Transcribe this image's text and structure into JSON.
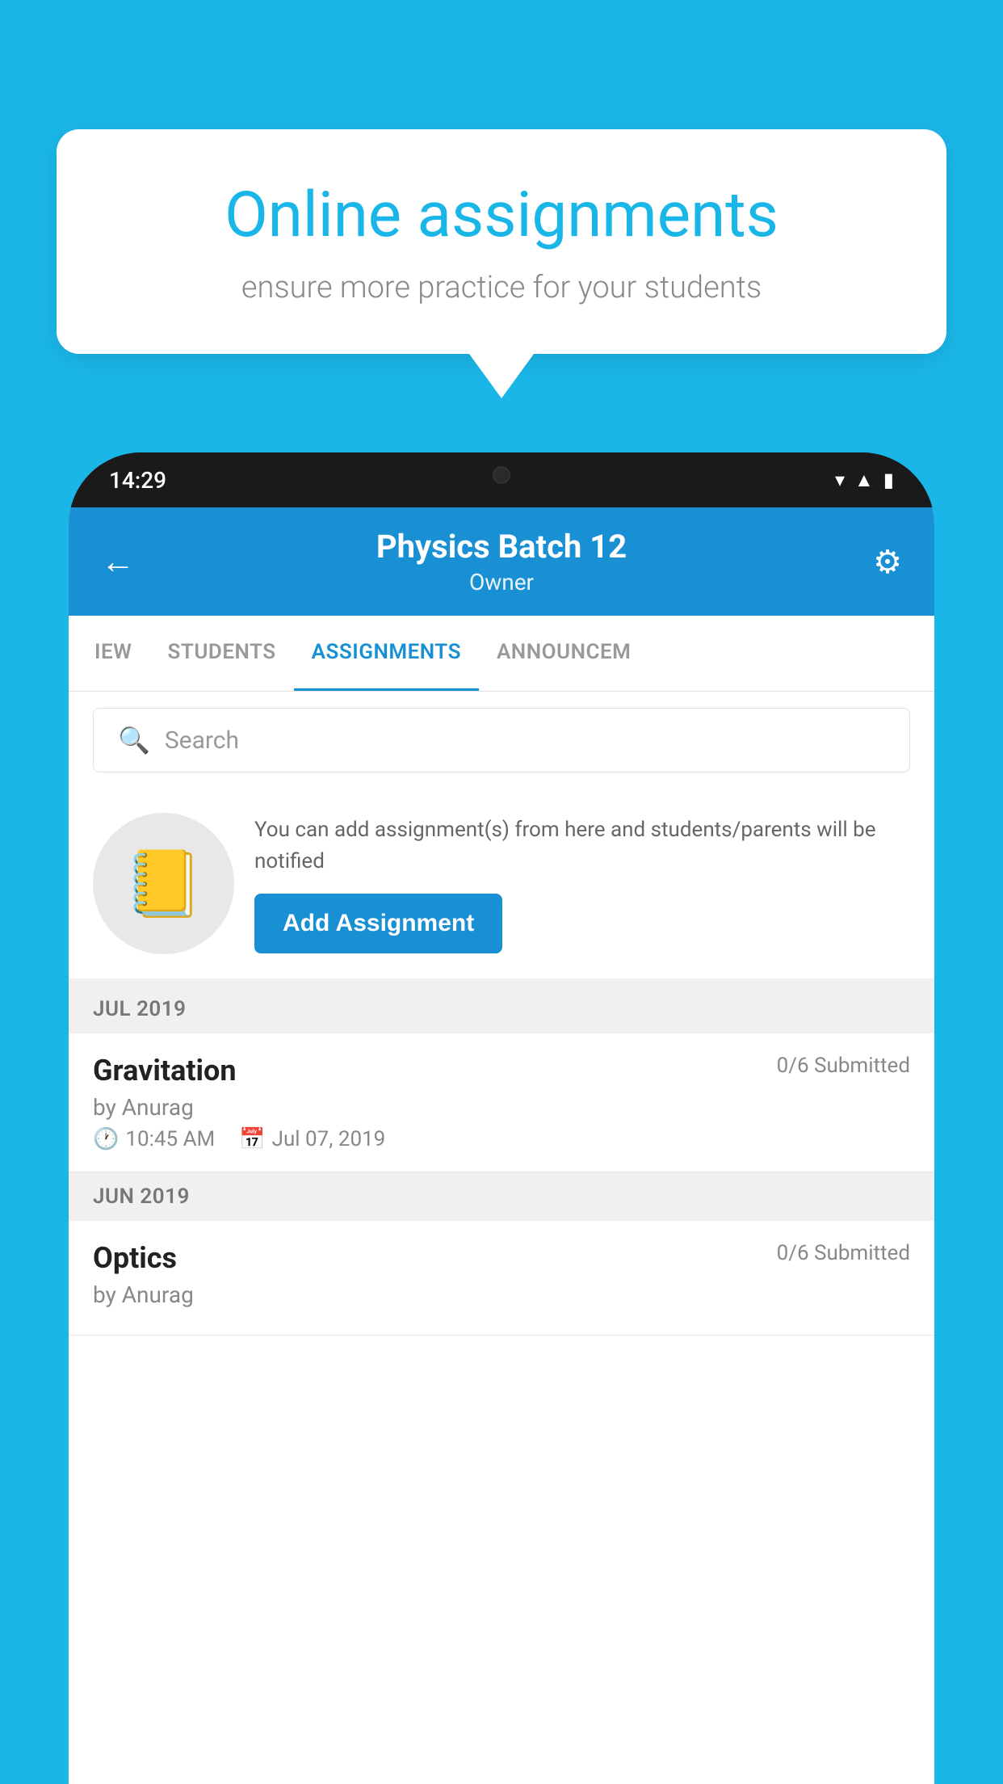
{
  "background_color": "#1ab6e8",
  "speech_bubble": {
    "title": "Online assignments",
    "subtitle": "ensure more practice for your students"
  },
  "phone": {
    "status_bar": {
      "time": "14:29"
    },
    "header": {
      "title": "Physics Batch 12",
      "subtitle": "Owner",
      "back_label": "←",
      "settings_label": "⚙"
    },
    "tabs": [
      {
        "label": "IEW",
        "active": false
      },
      {
        "label": "STUDENTS",
        "active": false
      },
      {
        "label": "ASSIGNMENTS",
        "active": true
      },
      {
        "label": "ANNOUNCEM",
        "active": false
      }
    ],
    "search": {
      "placeholder": "Search"
    },
    "promo": {
      "description": "You can add assignment(s) from here and students/parents will be notified",
      "button_label": "Add Assignment"
    },
    "sections": [
      {
        "month": "JUL 2019",
        "assignments": [
          {
            "name": "Gravitation",
            "submitted": "0/6 Submitted",
            "author": "by Anurag",
            "time": "10:45 AM",
            "date": "Jul 07, 2019"
          }
        ]
      },
      {
        "month": "JUN 2019",
        "assignments": [
          {
            "name": "Optics",
            "submitted": "0/6 Submitted",
            "author": "by Anurag",
            "time": "",
            "date": ""
          }
        ]
      }
    ]
  }
}
